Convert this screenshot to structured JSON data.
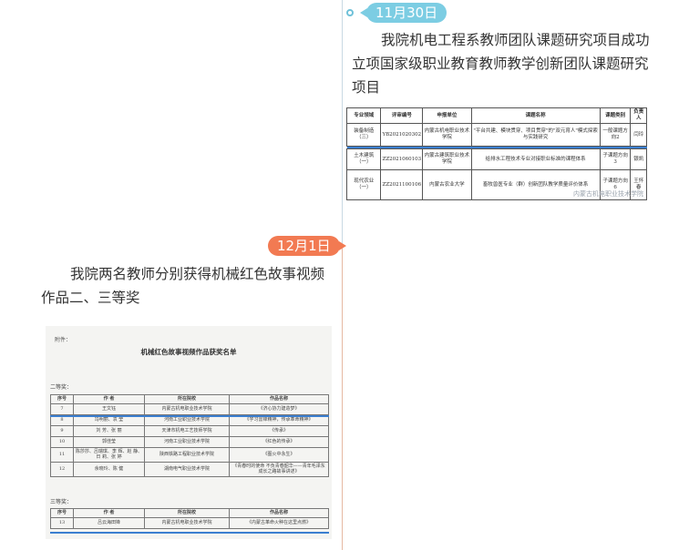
{
  "entry_1": {
    "date": "11月30日",
    "headline": "我院机电工程系教师团队课题研究项目成功立项国家级职业教育教师教学创新团队课题研究项目",
    "doc": {
      "headers": [
        "专业领域",
        "评审编号",
        "申报单位",
        "课题名称",
        "课题类别",
        "负责人"
      ],
      "rows": [
        [
          "装备制造（三）",
          "YB2021020302",
          "内蒙古机电职业技术学院",
          "\"平台共建、模块贯穿、项目贯穿\"的\"双元育人\"模式探索与实践研究",
          "一般课题方向2",
          "闫玲"
        ],
        [
          "土木建筑（一）",
          "ZZ2021060103",
          "内蒙古建筑职业技术学院",
          "给排水工程技术专业对接职业标准的课程体系",
          "子课题方向3",
          "银凯"
        ],
        [
          "现代农业（一）",
          "ZZ2021100106",
          "内蒙古农业大学",
          "畜牧兽医专业（群）创新团队教学质量评价体系",
          "子课题方向6",
          "王怀春"
        ]
      ],
      "watermark": "内蒙古机电职业技术学院"
    }
  },
  "entry_2": {
    "date": "12月1日",
    "headline": "我院两名教师分别获得机械红色故事视频作品二、三等奖",
    "doc": {
      "attachment": "附件：",
      "title": "机械红色故事视频作品获奖名单",
      "second_prize_label": "二等奖：",
      "third_prize_label": "三等奖：",
      "headers": [
        "序号",
        "作  者",
        "所在院校",
        "作品名称"
      ],
      "second_rows": [
        [
          "7",
          "王文钰",
          "内蒙古机电职业技术学院",
          "《济心协力建造梦》"
        ],
        [
          "8",
          "冯明丽、袁 莹",
          "河南工业职业技术学院",
          "《学习雷锋精神，传承革命精神》"
        ],
        [
          "9",
          "刘 芳、张 丽",
          "天津市机电工艺技师学院",
          "《传承》"
        ],
        [
          "10",
          "郭佳莹",
          "河南工业职业技术学院",
          "《红色的传承》"
        ],
        [
          "11",
          "陈莎莎、吕瑞琪、李 辉、赵 静、日 莉、张 婷",
          "陕西铁路工程职业技术学院",
          "《图火中永生》"
        ],
        [
          "12",
          "余晓玲、陈 健",
          "湖南电气职业技术学院",
          "《青春时的使命  不负青春韶华——青年毛泽东成长之路故事讲述》"
        ]
      ],
      "third_rows": [
        [
          "13",
          "吕云海田锋",
          "内蒙古机电职业技术学院",
          "《内蒙古革命火种在这里点燃》"
        ]
      ]
    }
  }
}
